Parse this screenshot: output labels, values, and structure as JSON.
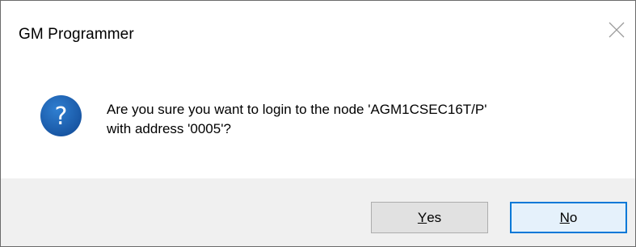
{
  "window": {
    "title": "GM Programmer",
    "close_icon": "close-icon"
  },
  "message": {
    "icon": "question-icon",
    "line1": "Are you sure you want to login to the node 'AGM1CSEC16T/P'",
    "line2": "with address '0005'?"
  },
  "buttons": {
    "yes": {
      "mnemonic": "Y",
      "rest": "es"
    },
    "no": {
      "mnemonic": "N",
      "rest": "o"
    }
  },
  "colors": {
    "accent": "#0078d7",
    "icon_blue": "#1c5fae",
    "footer_bg": "#f0f0f0"
  }
}
